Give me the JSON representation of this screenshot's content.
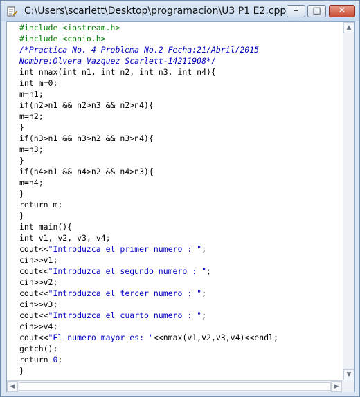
{
  "window": {
    "title": "C:\\Users\\scarlett\\Desktop\\programacion\\U3 P1 E2.cpp *",
    "controls": {
      "minimize": "–",
      "maximize": "□",
      "close": "✕"
    }
  },
  "code_lines": [
    [
      {
        "t": "#include <iostream.h>",
        "c": "kw-green"
      }
    ],
    [
      {
        "t": "#include <conio.h>",
        "c": "kw-green"
      }
    ],
    [
      {
        "t": "/*Practica No. 4 Problema No.2 Fecha:21/Abril/2015",
        "c": "comment"
      }
    ],
    [
      {
        "t": "Nombre:Olvera Vazquez Scarlett-14211908*/",
        "c": "comment"
      }
    ],
    [
      {
        "t": "int nmax(int n1, int n2, int n3, int n4){",
        "c": ""
      }
    ],
    [
      {
        "t": "int m=0;",
        "c": ""
      }
    ],
    [
      {
        "t": "m=n1;",
        "c": ""
      }
    ],
    [
      {
        "t": "if(n2>n1 && n2>n3 && n2>n4){",
        "c": ""
      }
    ],
    [
      {
        "t": "m=n2;",
        "c": ""
      }
    ],
    [
      {
        "t": "}",
        "c": ""
      }
    ],
    [
      {
        "t": "if(n3>n1 && n3>n2 && n3>n4){",
        "c": ""
      }
    ],
    [
      {
        "t": "m=n3;",
        "c": ""
      }
    ],
    [
      {
        "t": "}",
        "c": ""
      }
    ],
    [
      {
        "t": "if(n4>n1 && n4>n2 && n4>n3){",
        "c": ""
      }
    ],
    [
      {
        "t": "m=n4;",
        "c": ""
      }
    ],
    [
      {
        "t": "}",
        "c": ""
      }
    ],
    [
      {
        "t": "return m;",
        "c": ""
      }
    ],
    [
      {
        "t": "}",
        "c": ""
      }
    ],
    [
      {
        "t": "int main(){",
        "c": ""
      }
    ],
    [
      {
        "t": "int v1, v2, v3, v4;",
        "c": ""
      }
    ],
    [
      {
        "t": "cout<<",
        "c": ""
      },
      {
        "t": "\"Introduzca el primer numero : \"",
        "c": "blue"
      },
      {
        "t": ";",
        "c": ""
      }
    ],
    [
      {
        "t": "cin>>v1;",
        "c": ""
      }
    ],
    [
      {
        "t": "cout<<",
        "c": ""
      },
      {
        "t": "\"Introduzca el segundo numero : \"",
        "c": "blue"
      },
      {
        "t": ";",
        "c": ""
      }
    ],
    [
      {
        "t": "cin>>v2;",
        "c": ""
      }
    ],
    [
      {
        "t": "cout<<",
        "c": ""
      },
      {
        "t": "\"Introduzca el tercer numero : \"",
        "c": "blue"
      },
      {
        "t": ";",
        "c": ""
      }
    ],
    [
      {
        "t": "cin>>v3;",
        "c": ""
      }
    ],
    [
      {
        "t": "cout<<",
        "c": ""
      },
      {
        "t": "\"Introduzca el cuarto numero : \"",
        "c": "blue"
      },
      {
        "t": ";",
        "c": ""
      }
    ],
    [
      {
        "t": "cin>>v4;",
        "c": ""
      }
    ],
    [
      {
        "t": "cout<<",
        "c": ""
      },
      {
        "t": "\"El numero mayor es: \"",
        "c": "blue"
      },
      {
        "t": "<<nmax(v1,v2,v3,v4)<<endl;",
        "c": ""
      }
    ],
    [
      {
        "t": "getch();",
        "c": ""
      }
    ],
    [
      {
        "t": "return ",
        "c": ""
      },
      {
        "t": "0",
        "c": "blue"
      },
      {
        "t": ";",
        "c": ""
      }
    ],
    [
      {
        "t": "}",
        "c": ""
      }
    ]
  ],
  "colors": {
    "include": "#008000",
    "string": "#0000c0",
    "comment": "#0000c0",
    "title_bar": "#c7d8ee"
  }
}
